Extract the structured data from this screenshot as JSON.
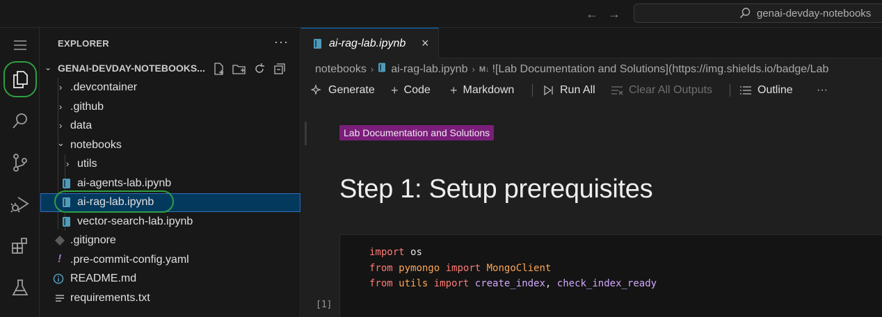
{
  "titlebar": {
    "back_glyph": "←",
    "forward_glyph": "→",
    "command_center_text": "genai-devday-notebooks"
  },
  "activity_bar": {
    "items": [
      "explorer-icon",
      "search-icon",
      "source-control-icon",
      "run-debug-icon",
      "extensions-icon",
      "testing-icon"
    ]
  },
  "explorer": {
    "title": "EXPLORER",
    "more": "···",
    "root": "GENAI-DEVDAY-NOTEBOOKS...",
    "tree": {
      "devcontainer": ".devcontainer",
      "github": ".github",
      "data": "data",
      "notebooks": "notebooks",
      "utils": "utils",
      "agents_lab": "ai-agents-lab.ipynb",
      "rag_lab": "ai-rag-lab.ipynb",
      "vector_lab": "vector-search-lab.ipynb",
      "gitignore": ".gitignore",
      "precommit": ".pre-commit-config.yaml",
      "readme": "README.md",
      "requirements": "requirements.txt"
    }
  },
  "editor": {
    "tab_label": "ai-rag-lab.ipynb",
    "tab_close": "×",
    "breadcrumb": {
      "folder": "notebooks",
      "file": "ai-rag-lab.ipynb",
      "md_tag": "M↓",
      "cell": "![Lab Documentation and Solutions](https://img.shields.io/badge/Lab"
    },
    "toolbar": {
      "generate": "Generate",
      "code": "Code",
      "markdown": "Markdown",
      "run_all": "Run All",
      "clear_outputs": "Clear All Outputs",
      "outline": "Outline",
      "more": "···"
    },
    "markdown_cell": {
      "badge": "Lab Documentation and Solutions",
      "heading": "Step 1: Setup prerequisites"
    },
    "code_cell": {
      "line1": {
        "kw": "import",
        "mod": "os"
      },
      "line2": {
        "kw1": "from",
        "mod": "pymongo",
        "kw2": "import",
        "name": "MongoClient"
      },
      "line3": {
        "kw1": "from",
        "mod": "utils",
        "kw2": "import",
        "fn1": "create_index",
        "sep": ", ",
        "fn2": "check_index_ready"
      },
      "exec_count": "[1]"
    }
  }
}
